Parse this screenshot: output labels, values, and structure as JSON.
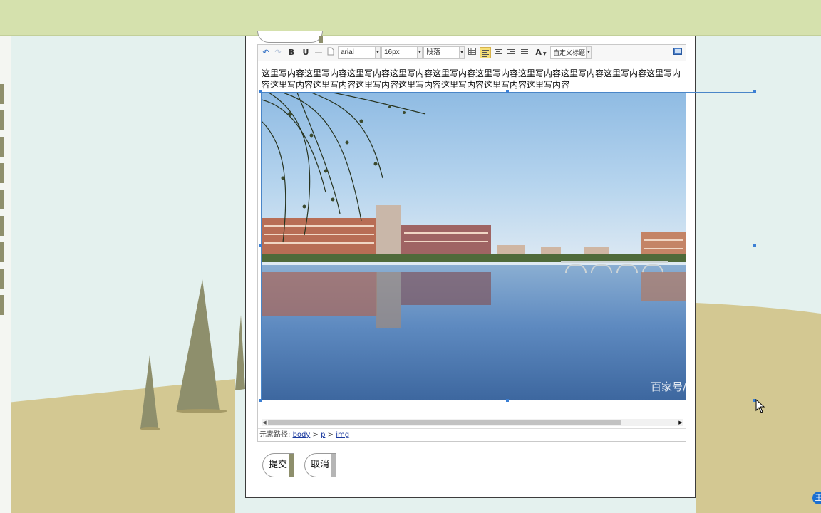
{
  "colors": {
    "top_band": "#d5e1ad",
    "sky": "#e4f1ee",
    "ground": "#d3c892",
    "tree": "#8e8f6c",
    "selection": "#3b7fd4",
    "active_align": "#f6df77"
  },
  "toolbar": {
    "undo_icon": "undo-icon",
    "redo_icon": "redo-icon",
    "bold_label": "B",
    "underline_label": "U",
    "hr_label": "—",
    "font_family": "arial",
    "font_size": "16px",
    "paragraph": "段落",
    "font_color_label": "A",
    "custom_heading": "自定义标题",
    "fullscreen_icon": "fullscreen-icon"
  },
  "editor": {
    "content_text": "这里写内容这里写内容这里写内容这里写内容这里写内容这里写内容这里写内容这里写内容这里写内容这里写内容这里写内容这里写内容这里写内容这里写内容这里写内容这里写内容这里写内容",
    "image_watermark": "百家号/",
    "element_path_label": "元素路径:",
    "path_body": "body",
    "path_sep": ">",
    "path_p": "p",
    "path_img": "img"
  },
  "actions": {
    "submit_label": "提交",
    "cancel_label": "取消"
  },
  "badge": {
    "text": "王"
  }
}
